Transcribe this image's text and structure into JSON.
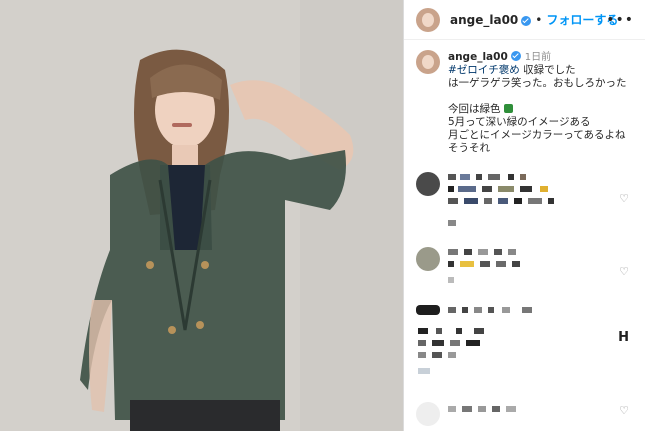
{
  "header": {
    "username": "ange_la00",
    "separator": "•",
    "follow_label": "フォローする",
    "more_label": "•••"
  },
  "caption": {
    "username": "ange_la00",
    "time": "1日前",
    "hashtag": "#ゼロイチ褒め",
    "line1_rest": " 収録でした",
    "line2": "は一ゲラゲラ笑った。おもしろかった",
    "line3": "今回は緑色",
    "line4": "5月って深い緑のイメージある",
    "line5": "月ごとにイメージカラーってあるよね",
    "line6": "そうそれ"
  },
  "icons": {
    "verified": "verified-badge-icon",
    "green_square": "green-square-emoji",
    "heart": "heart-icon"
  },
  "colors": {
    "link_blue": "#0095f6",
    "hashtag": "#00376b",
    "shirt_green": "#3f5147"
  }
}
